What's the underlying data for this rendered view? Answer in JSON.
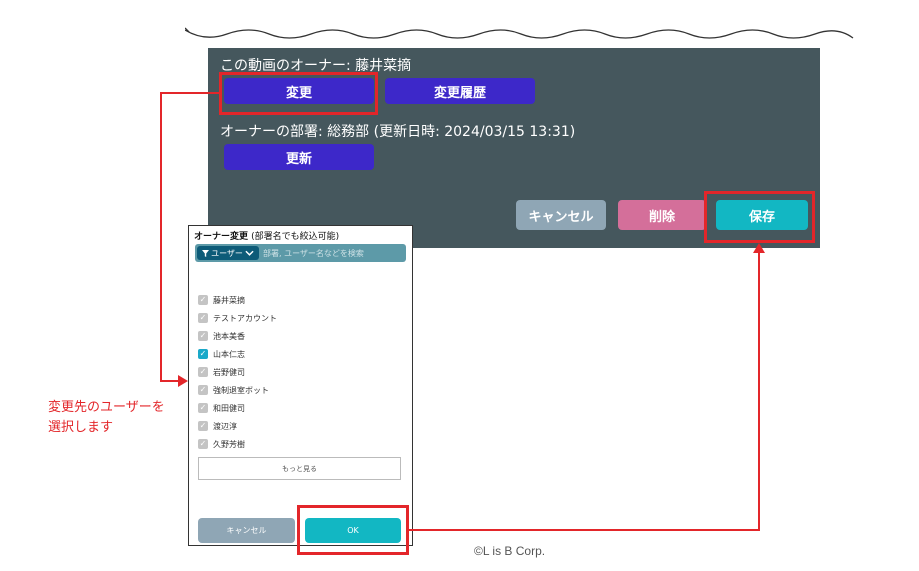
{
  "panel": {
    "owner_text": "この動画のオーナー: 藤井菜摘",
    "change_button": "変更",
    "history_button": "変更履歴",
    "department_text": "オーナーの部署: 総務部 (更新日時: 2024/03/15 13:31)",
    "update_button": "更新",
    "cancel_button": "キャンセル",
    "delete_button": "削除",
    "save_button": "保存"
  },
  "dialog": {
    "title": "オーナー変更",
    "title_note": "(部署名でも絞込可能)",
    "filter_label": "ユーザー",
    "search_placeholder": "部署, ユーザー名などを検索",
    "users": [
      {
        "name": "藤井菜摘",
        "checked": false
      },
      {
        "name": "テストアカウント",
        "checked": false
      },
      {
        "name": "池本美香",
        "checked": false
      },
      {
        "name": "山本仁志",
        "checked": true
      },
      {
        "name": "岩野健司",
        "checked": false
      },
      {
        "name": "強制退室ボット",
        "checked": false
      },
      {
        "name": "和田健司",
        "checked": false
      },
      {
        "name": "渡辺淳",
        "checked": false
      },
      {
        "name": "久野芳樹",
        "checked": false
      }
    ],
    "more_button": "もっと見る",
    "cancel_button": "キャンセル",
    "ok_button": "OK"
  },
  "annotation": {
    "line1": "変更先のユーザーを",
    "line2": "選択します"
  },
  "footer": {
    "copyright": "©L is B Corp."
  },
  "colors": {
    "panel_bg": "#45575d",
    "primary": "#3d28c9",
    "teal": "#12b7c3",
    "pink": "#d46f9a",
    "gray": "#8fa6b5",
    "annotation_red": "#e3262a"
  }
}
